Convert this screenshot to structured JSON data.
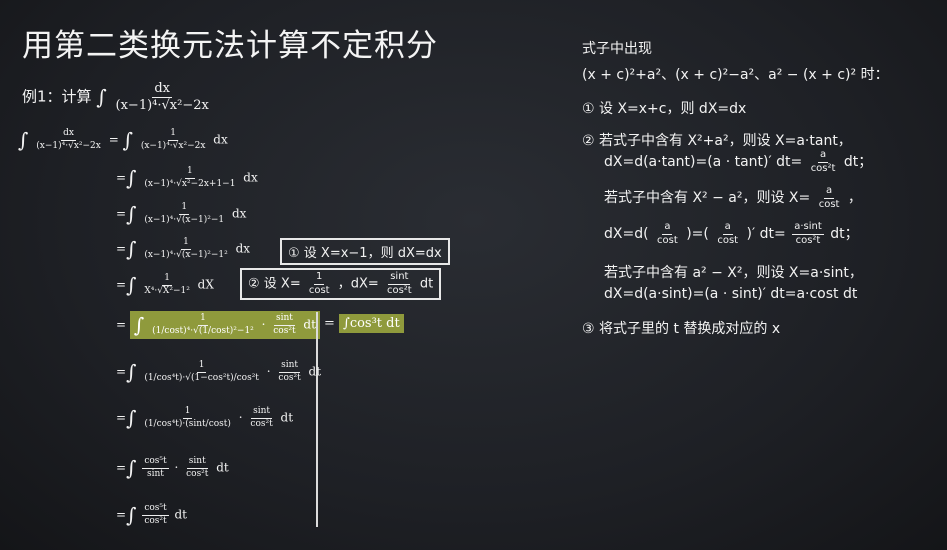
{
  "title": "用第二类换元法计算不定积分",
  "example": {
    "label": "例1：计算",
    "integrand_num": "dx",
    "integrand_den": "(x−1)⁴·√x²−2x"
  },
  "steps": [
    {
      "lhs_num": "dx",
      "lhs_den": "(x−1)⁴·√x²−2x",
      "num": "1",
      "den": "(x−1)⁴·√x²−2x",
      "tail": "dx"
    },
    {
      "num": "1",
      "den": "(x−1)⁴·√x²−2x+1−1",
      "tail": "dx"
    },
    {
      "num": "1",
      "den": "(x−1)⁴·√(x−1)²−1",
      "tail": "dx"
    },
    {
      "num": "1",
      "den": "(x−1)⁴·√(x−1)²−1²",
      "tail": "dx"
    },
    {
      "num": "1",
      "den": "X⁴·√X²−1²",
      "tail": "dX"
    }
  ],
  "notes": {
    "sub1": "① 设 X=x−1，则 dX=dx",
    "sub2_prefix": "② 设 X=",
    "sub2_frac_num": "1",
    "sub2_frac_den": "cost",
    "sub2_mid": "，dX=",
    "sub2_dx_num": "sint",
    "sub2_dx_den": "cos²t",
    "sub2_tail": "dt"
  },
  "highlight": {
    "num": "1",
    "den": "(1/cost)⁴·√(1/cost)²−1²",
    "mid_num": "sint",
    "mid_den": "cos²t",
    "tail": "dt",
    "result": "∫cos³t dt"
  },
  "later_steps": [
    {
      "num": "1",
      "den": "(1/cos⁴t)·√(1−cos²t)/cos²t",
      "f_num": "sint",
      "f_den": "cos²t",
      "tail": "dt"
    },
    {
      "num": "1",
      "den": "(1/cos⁴t)·(sint/cost)",
      "f_num": "sint",
      "f_den": "cos²t",
      "tail": "dt"
    },
    {
      "num": "cos⁵t",
      "den": "sint",
      "f_num": "sint",
      "f_den": "cos²t",
      "tail": "dt"
    },
    {
      "num": "cos⁵t",
      "den": "cos²t",
      "tail": "dt"
    }
  ],
  "right": {
    "heading": "式子中出现",
    "cases": "(x + c)²+a²、(x + c)²−a²、a² − (x + c)² 时：",
    "r1": "① 设 X=x+c，则 dX=dx",
    "r2": "② 若式子中含有 X²+a²，则设 X=a·tant，",
    "r2b_a": "dX=d(a·tant)=(a · tant)′ dt=",
    "r2b_num": "a",
    "r2b_den": "cos²t",
    "r2b_tail": "dt；",
    "r3_a": "若式子中含有 X² − a²，则设 X=",
    "r3_num": "a",
    "r3_den": "cost",
    "r3_tail": "，",
    "r3b_a": "dX=d(",
    "r3b_num1": "a",
    "r3b_den1": "cost",
    "r3b_mid": ")=(",
    "r3b_num2": "a",
    "r3b_den2": "cost",
    "r3b_mid2": ")′ dt=",
    "r3b_num3": "a·sint",
    "r3b_den3": "cos²t",
    "r3b_tail": "dt；",
    "r4": "若式子中含有 a² − X²，则设 X=a·sint，",
    "r4b": "dX=d(a·sint)=(a · sint)′ dt=a·cost dt",
    "r5": "③ 将式子里的 t 替换成对应的 x"
  }
}
